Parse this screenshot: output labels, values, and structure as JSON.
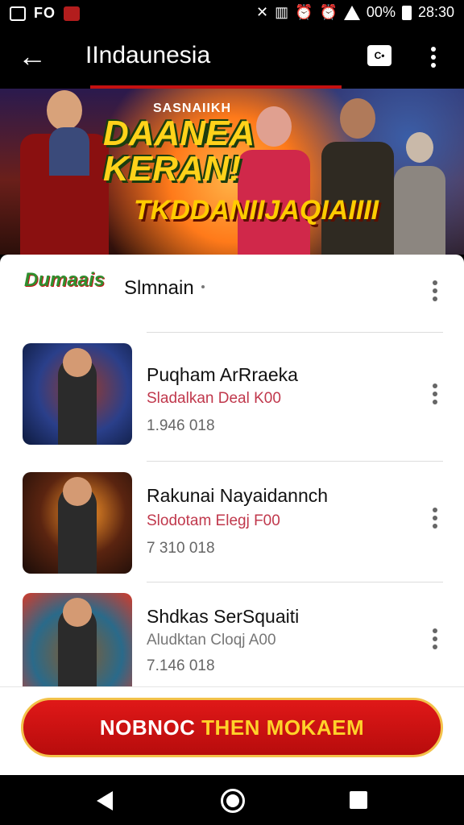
{
  "status_bar": {
    "left_text": "FO",
    "right_text": "00%",
    "time": "28:30",
    "icons": [
      "photo-icon",
      "notification-icon",
      "mute-icon",
      "vibrate-icon",
      "alarm-icon",
      "alarm-icon",
      "wifi-icon",
      "signal-icon",
      "battery-icon"
    ]
  },
  "app_bar": {
    "title": "IIndaunesia",
    "chat_icon_label": "C•",
    "icons": [
      "back-arrow-icon",
      "chat-icon",
      "more-vert-icon"
    ]
  },
  "banner": {
    "small_text": "SASNAIIKH",
    "headline_line1": "DAANEA",
    "headline_line2": "KERAN!",
    "subtitle": "TKDDANIIJAQIAIIII"
  },
  "section": {
    "logo_text": "Dumaais",
    "title": "Slmnain"
  },
  "items": [
    {
      "title": "Puqham ArRraeka",
      "subtitle": "Sladalkan Deal K00",
      "meta": "1.946 018"
    },
    {
      "title": "Rakunai Nayaidannch",
      "subtitle": "Slodotam Elegj F00",
      "meta": "7 310 018"
    },
    {
      "title": "Shdkas SerSquaiti",
      "subtitle": "Aludktan Cloqj A00",
      "meta": "7.146 018"
    }
  ],
  "cta": {
    "label_part1": "NOBNOC ",
    "label_part2": "THEN MOKAEM"
  },
  "colors": {
    "accent_red": "#c41010",
    "cta_gold": "#f3c24a",
    "subtitle_pink": "#c0384c"
  }
}
